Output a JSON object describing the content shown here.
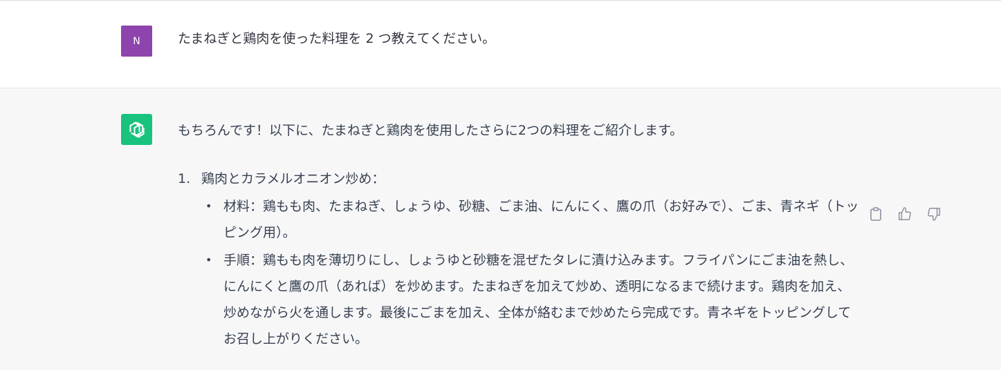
{
  "user_message": {
    "avatar_initial": "N",
    "text": "たまねぎと鶏肉を使った料理を 2 つ教えてください。"
  },
  "assistant_message": {
    "intro": "もちろんです！以下に、たまねぎと鶏肉を使用したさらに2つの料理をご紹介します。",
    "items": [
      {
        "number": "1.",
        "title": "鶏肉とカラメルオニオン炒め：",
        "bullets": [
          "材料：鶏もも肉、たまねぎ、しょうゆ、砂糖、ごま油、にんにく、鷹の爪（お好みで）、ごま、青ネギ（トッピング用）。",
          "手順：鶏もも肉を薄切りにし、しょうゆと砂糖を混ぜたタレに漬け込みます。フライパンにごま油を熱し、にんにくと鷹の爪（あれば）を炒めます。たまねぎを加えて炒め、透明になるまで続けます。鶏肉を加え、炒めながら火を通します。最後にごまを加え、全体が絡むまで炒めたら完成です。青ネギをトッピングしてお召し上がりください。"
        ]
      }
    ]
  },
  "actions": {
    "copy_icon": "clipboard-icon",
    "like_icon": "thumbs-up-icon",
    "dislike_icon": "thumbs-down-icon"
  },
  "colors": {
    "user_avatar": "#8e44ad",
    "bot_avatar": "#19c37d",
    "bot_background": "#f7f7f8"
  }
}
